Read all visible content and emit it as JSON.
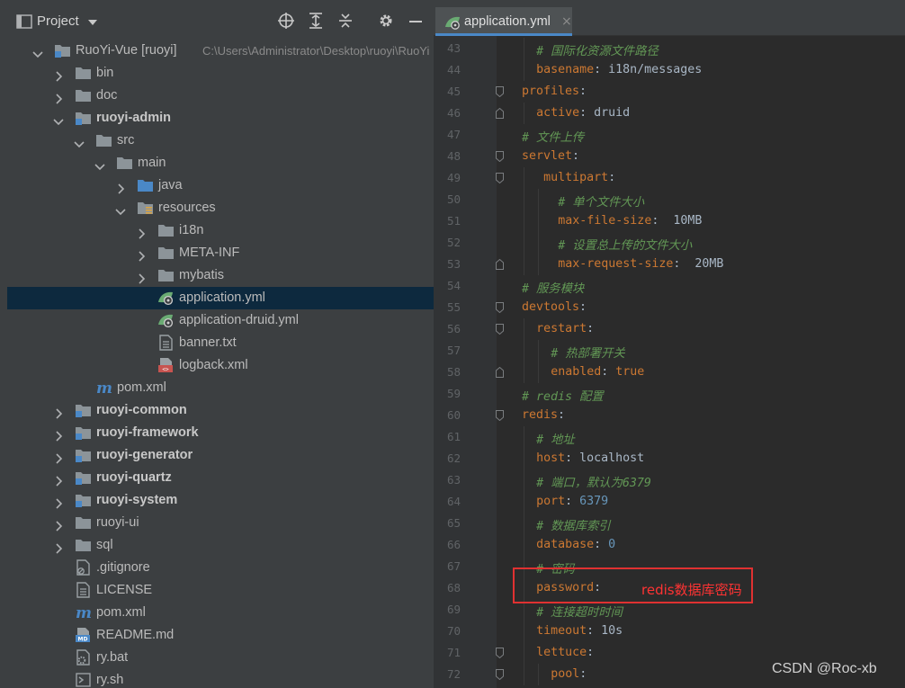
{
  "project_panel": {
    "title": "Project",
    "header_icons": [
      "target-icon",
      "expand-all-icon",
      "collapse-all-icon",
      "gear-icon",
      "minimize-icon"
    ],
    "tree": [
      {
        "label": "RuoYi-Vue [ruoyi]",
        "hint": "C:\\Users\\Administrator\\Desktop\\ruoyi\\RuoYi",
        "depth": 0,
        "chevron": "down",
        "icon": "module-folder",
        "bold": false
      },
      {
        "label": "bin",
        "depth": 1,
        "chevron": "right",
        "icon": "folder"
      },
      {
        "label": "doc",
        "depth": 1,
        "chevron": "right",
        "icon": "folder"
      },
      {
        "label": "ruoyi-admin",
        "depth": 1,
        "chevron": "down",
        "icon": "module-folder",
        "bold": true
      },
      {
        "label": "src",
        "depth": 2,
        "chevron": "down",
        "icon": "folder"
      },
      {
        "label": "main",
        "depth": 3,
        "chevron": "down",
        "icon": "folder"
      },
      {
        "label": "java",
        "depth": 4,
        "chevron": "right",
        "icon": "source-folder"
      },
      {
        "label": "resources",
        "depth": 4,
        "chevron": "down",
        "icon": "resources-folder"
      },
      {
        "label": "i18n",
        "depth": 5,
        "chevron": "right",
        "icon": "folder"
      },
      {
        "label": "META-INF",
        "depth": 5,
        "chevron": "right",
        "icon": "folder"
      },
      {
        "label": "mybatis",
        "depth": 5,
        "chevron": "right",
        "icon": "folder"
      },
      {
        "label": "application.yml",
        "depth": 5,
        "chevron": "none",
        "icon": "spring-yml",
        "selected": true
      },
      {
        "label": "application-druid.yml",
        "depth": 5,
        "chevron": "none",
        "icon": "spring-yml"
      },
      {
        "label": "banner.txt",
        "depth": 5,
        "chevron": "none",
        "icon": "text-file"
      },
      {
        "label": "logback.xml",
        "depth": 5,
        "chevron": "none",
        "icon": "xml-file"
      },
      {
        "label": "pom.xml",
        "depth": 2,
        "chevron": "none",
        "icon": "maven"
      },
      {
        "label": "ruoyi-common",
        "depth": 1,
        "chevron": "right",
        "icon": "module-folder",
        "bold": true
      },
      {
        "label": "ruoyi-framework",
        "depth": 1,
        "chevron": "right",
        "icon": "module-folder",
        "bold": true
      },
      {
        "label": "ruoyi-generator",
        "depth": 1,
        "chevron": "right",
        "icon": "module-folder",
        "bold": true
      },
      {
        "label": "ruoyi-quartz",
        "depth": 1,
        "chevron": "right",
        "icon": "module-folder",
        "bold": true
      },
      {
        "label": "ruoyi-system",
        "depth": 1,
        "chevron": "right",
        "icon": "module-folder",
        "bold": true
      },
      {
        "label": "ruoyi-ui",
        "depth": 1,
        "chevron": "right",
        "icon": "folder"
      },
      {
        "label": "sql",
        "depth": 1,
        "chevron": "right",
        "icon": "folder"
      },
      {
        "label": ".gitignore",
        "depth": 1,
        "chevron": "none",
        "icon": "ignore-file"
      },
      {
        "label": "LICENSE",
        "depth": 1,
        "chevron": "none",
        "icon": "text-file"
      },
      {
        "label": "pom.xml",
        "depth": 1,
        "chevron": "none",
        "icon": "maven"
      },
      {
        "label": "README.md",
        "depth": 1,
        "chevron": "none",
        "icon": "markdown-file"
      },
      {
        "label": "ry.bat",
        "depth": 1,
        "chevron": "none",
        "icon": "script-file"
      },
      {
        "label": "ry.sh",
        "depth": 1,
        "chevron": "none",
        "icon": "shell-file"
      }
    ]
  },
  "editor": {
    "tab": {
      "label": "application.yml",
      "close": "×",
      "icon": "spring-yml"
    },
    "lines": [
      {
        "n": 43,
        "indent": 2,
        "parts": [
          [
            "c",
            "# 国际化资源文件路径"
          ]
        ]
      },
      {
        "n": 44,
        "indent": 2,
        "parts": [
          [
            "k",
            "basename"
          ],
          [
            "v",
            ": i18n/messages"
          ]
        ]
      },
      {
        "n": 45,
        "indent": 0,
        "fold": true,
        "parts": [
          [
            "k",
            "profiles"
          ],
          [
            "v",
            ":"
          ]
        ]
      },
      {
        "n": 46,
        "indent": 2,
        "parts": [
          [
            "k",
            "active"
          ],
          [
            "v",
            ": druid"
          ]
        ],
        "fold_end": true
      },
      {
        "n": 47,
        "indent": 0,
        "parts": [
          [
            "c",
            "# 文件上传"
          ]
        ]
      },
      {
        "n": 48,
        "indent": 0,
        "fold": true,
        "parts": [
          [
            "k",
            "servlet"
          ],
          [
            "v",
            ":"
          ]
        ]
      },
      {
        "n": 49,
        "indent": 3,
        "fold": true,
        "parts": [
          [
            "k",
            "multipart"
          ],
          [
            "v",
            ":"
          ]
        ]
      },
      {
        "n": 50,
        "indent": 5,
        "parts": [
          [
            "c",
            "# 单个文件大小"
          ]
        ]
      },
      {
        "n": 51,
        "indent": 5,
        "parts": [
          [
            "k",
            "max-file-size"
          ],
          [
            "v",
            ":  10MB"
          ]
        ]
      },
      {
        "n": 52,
        "indent": 5,
        "parts": [
          [
            "c",
            "# 设置总上传的文件大小"
          ]
        ]
      },
      {
        "n": 53,
        "indent": 5,
        "parts": [
          [
            "k",
            "max-request-size"
          ],
          [
            "v",
            ":  20MB"
          ]
        ],
        "fold_end": true
      },
      {
        "n": 54,
        "indent": 0,
        "parts": [
          [
            "c",
            "# 服务模块"
          ]
        ]
      },
      {
        "n": 55,
        "indent": 0,
        "fold": true,
        "parts": [
          [
            "k",
            "devtools"
          ],
          [
            "v",
            ":"
          ]
        ]
      },
      {
        "n": 56,
        "indent": 2,
        "fold": true,
        "parts": [
          [
            "k",
            "restart"
          ],
          [
            "v",
            ":"
          ]
        ]
      },
      {
        "n": 57,
        "indent": 4,
        "parts": [
          [
            "c",
            "# 热部署开关"
          ]
        ]
      },
      {
        "n": 58,
        "indent": 4,
        "parts": [
          [
            "k",
            "enabled"
          ],
          [
            "v",
            ": "
          ],
          [
            "k",
            "true"
          ]
        ],
        "fold_end": true
      },
      {
        "n": 59,
        "indent": 0,
        "parts": [
          [
            "c",
            "# redis 配置"
          ]
        ]
      },
      {
        "n": 60,
        "indent": 0,
        "fold": true,
        "parts": [
          [
            "k",
            "redis"
          ],
          [
            "v",
            ":"
          ]
        ]
      },
      {
        "n": 61,
        "indent": 2,
        "parts": [
          [
            "c",
            "# 地址"
          ]
        ]
      },
      {
        "n": 62,
        "indent": 2,
        "parts": [
          [
            "k",
            "host"
          ],
          [
            "v",
            ": localhost"
          ]
        ]
      },
      {
        "n": 63,
        "indent": 2,
        "parts": [
          [
            "c",
            "# 端口，默认为6379"
          ]
        ]
      },
      {
        "n": 64,
        "indent": 2,
        "parts": [
          [
            "k",
            "port"
          ],
          [
            "v",
            ": "
          ],
          [
            "num",
            "6379"
          ]
        ]
      },
      {
        "n": 65,
        "indent": 2,
        "parts": [
          [
            "c",
            "# 数据库索引"
          ]
        ]
      },
      {
        "n": 66,
        "indent": 2,
        "parts": [
          [
            "k",
            "database"
          ],
          [
            "v",
            ": "
          ],
          [
            "num",
            "0"
          ]
        ]
      },
      {
        "n": 67,
        "indent": 2,
        "parts": [
          [
            "c",
            "# 密码"
          ]
        ]
      },
      {
        "n": 68,
        "indent": 2,
        "parts": [
          [
            "k",
            "password"
          ],
          [
            "v",
            ":"
          ]
        ]
      },
      {
        "n": 69,
        "indent": 2,
        "parts": [
          [
            "c",
            "# 连接超时时间"
          ]
        ]
      },
      {
        "n": 70,
        "indent": 2,
        "parts": [
          [
            "k",
            "timeout"
          ],
          [
            "v",
            ": 10s"
          ]
        ]
      },
      {
        "n": 71,
        "indent": 2,
        "fold": true,
        "parts": [
          [
            "k",
            "lettuce"
          ],
          [
            "v",
            ":"
          ]
        ]
      },
      {
        "n": 72,
        "indent": 4,
        "fold": true,
        "parts": [
          [
            "k",
            "pool"
          ],
          [
            "v",
            ":"
          ]
        ]
      }
    ]
  },
  "annotation": {
    "text": "redis数据库密码",
    "color": "#ff3333"
  },
  "watermark": "CSDN @Roc-xb",
  "colors": {
    "keyword": "#cc7832",
    "value": "#a9b7c6",
    "number": "#6897bb",
    "comment": "#629755",
    "selection": "#0d293e",
    "panel": "#3c3f41",
    "editor": "#2b2b2b"
  }
}
